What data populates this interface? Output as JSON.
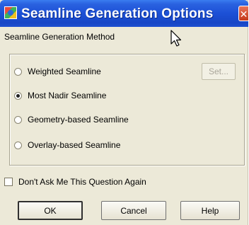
{
  "window": {
    "title": "Seamline Generation Options",
    "close_glyph": "✕",
    "app_icon": "seamline-app-icon"
  },
  "method_group": {
    "label": "Seamline Generation Method",
    "options": [
      {
        "label": "Weighted Seamline",
        "checked": false
      },
      {
        "label": "Most Nadir Seamline",
        "checked": true
      },
      {
        "label": "Geometry-based Seamline",
        "checked": false
      },
      {
        "label": "Overlay-based Seamline",
        "checked": false
      }
    ],
    "set_button": "Set..."
  },
  "dont_ask": {
    "label": "Don't Ask Me This Question Again",
    "checked": false
  },
  "buttons": {
    "ok": "OK",
    "cancel": "Cancel",
    "help": "Help"
  },
  "colors": {
    "titlebar": "#1c50d6",
    "dialog_background": "#ece9d8",
    "close_button": "#c4391a"
  }
}
